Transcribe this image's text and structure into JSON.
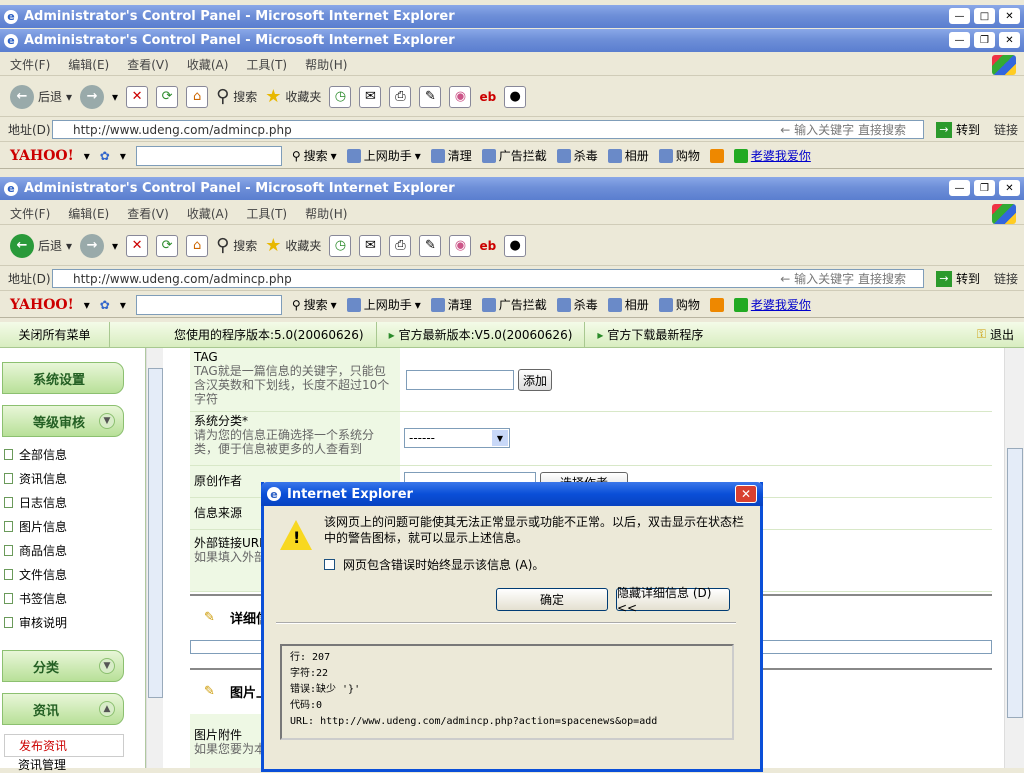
{
  "window_title": "Administrator's Control Panel - Microsoft Internet Explorer",
  "menu": [
    "文件(F)",
    "编辑(E)",
    "查看(V)",
    "收藏(A)",
    "工具(T)",
    "帮助(H)"
  ],
  "toolbar": {
    "back": "后退",
    "search": "搜索",
    "favorites": "收藏夹"
  },
  "address": {
    "label": "地址(D)",
    "url": "http://www.udeng.com/admincp.php",
    "hint": "输入关键字 直接搜索",
    "go": "转到",
    "links": "链接"
  },
  "yahoo": {
    "logo": "YAHOO!",
    "search": "搜索",
    "helper": "上网助手",
    "clean": "清理",
    "adblock": "广告拦截",
    "antivirus": "杀毒",
    "album": "相册",
    "shop": "购物",
    "link": "老婆我爱你"
  },
  "status_bar": {
    "close_all": "关闭所有菜单",
    "version": "您使用的程序版本:5.0(20060626)",
    "latest": "官方最新版本:V5.0(20060626)",
    "download": "官方下载最新程序",
    "logout": "退出"
  },
  "sidebar": {
    "groups": [
      "系统设置",
      "等级审核",
      "分类",
      "资讯"
    ],
    "items": [
      "全部信息",
      "资讯信息",
      "日志信息",
      "图片信息",
      "商品信息",
      "文件信息",
      "书签信息",
      "审核说明"
    ],
    "sub": [
      "发布资讯",
      "资讯管理"
    ]
  },
  "form": {
    "tag": {
      "label": "TAG",
      "desc": "TAG就是一篇信息的关键字，只能包含汉英数和下划线，长度不超过10个字符",
      "button": "添加"
    },
    "category": {
      "label": "系统分类*",
      "desc": "请为您的信息正确选择一个系统分类，便于信息被更多的人查看到",
      "value": "------"
    },
    "author": {
      "label": "原创作者",
      "button": "选择作者"
    },
    "source": {
      "label": "信息来源"
    },
    "link": {
      "label": "外部链接URL",
      "desc": "如果填入外部...将自动跳转至..."
    },
    "section_detail": "详细信息",
    "section_image": "图片上传",
    "image": {
      "label": "图片附件",
      "desc": "如果您要为本...通过此处上..."
    }
  },
  "dialog": {
    "title": "Internet Explorer",
    "message": "该网页上的问题可能使其无法正常显示或功能不正常。以后，双击显示在状态栏中的警告图标，就可以显示上述信息。",
    "checkbox": "网页包含错误时始终显示该信息 (A)。",
    "ok": "确定",
    "hide": "隐藏详细信息 (D) <<",
    "details": [
      "行:  207",
      "字符:22",
      "错误:缺少 '}'",
      "代码:0",
      "URL:  http://www.udeng.com/admincp.php?action=spacenews&op=add"
    ]
  }
}
